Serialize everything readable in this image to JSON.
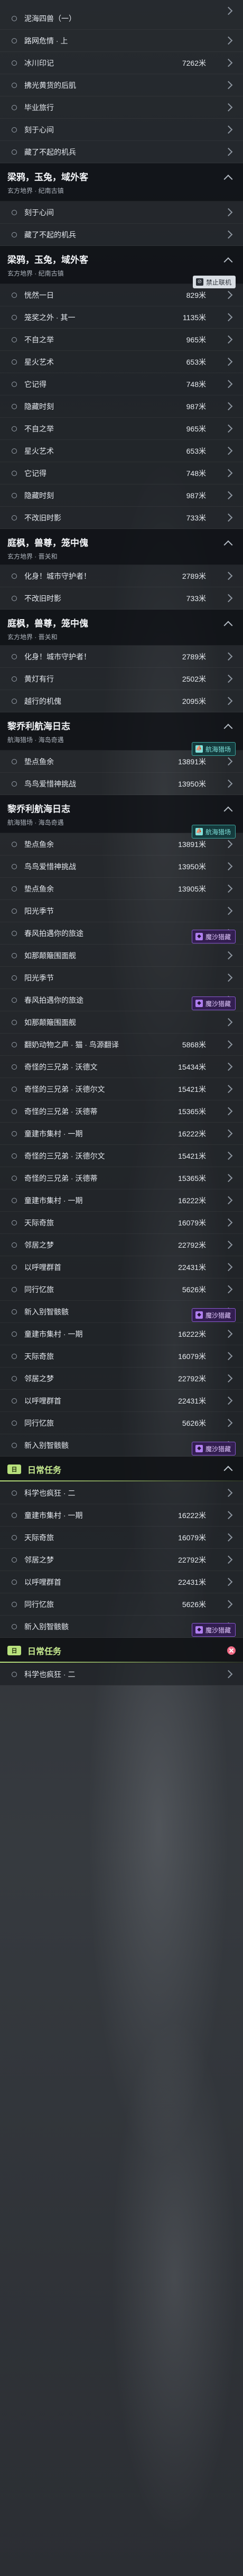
{
  "rows": [
    {
      "kind": "row",
      "name": "泥海四兽（一）",
      "dist": "",
      "lead": true
    },
    {
      "kind": "row",
      "name": "路网危情 · 上",
      "dist": ""
    },
    {
      "kind": "row",
      "name": "冰川印记",
      "dist": "7262米"
    },
    {
      "kind": "row",
      "name": "拂光黄货的后肌",
      "dist": ""
    },
    {
      "kind": "row",
      "name": "毕业旅行",
      "dist": ""
    },
    {
      "kind": "row",
      "name": "刻于心间",
      "dist": ""
    },
    {
      "kind": "row",
      "name": "藏了不起的机兵",
      "dist": ""
    },
    {
      "kind": "header",
      "title": "梁鸦，玉兔，域外客",
      "sub": "玄方地界 · 纪南古镇"
    },
    {
      "kind": "row",
      "name": "刻于心间",
      "dist": ""
    },
    {
      "kind": "row",
      "name": "藏了不起的机兵",
      "dist": ""
    },
    {
      "kind": "header",
      "title": "梁鸦，玉兔，域外客",
      "sub": "玄方地界 · 纪南古镇",
      "badge": {
        "style": "ban",
        "icon": "⊘",
        "text": "禁止联机"
      }
    },
    {
      "kind": "row",
      "name": "恍然一日",
      "dist": "829米"
    },
    {
      "kind": "row",
      "name": "笼奖之外 · 其一",
      "dist": "1135米"
    },
    {
      "kind": "row",
      "name": "不自之举",
      "dist": "965米"
    },
    {
      "kind": "row",
      "name": "星火艺术",
      "dist": "653米"
    },
    {
      "kind": "row",
      "name": "它记得",
      "dist": "748米"
    },
    {
      "kind": "row",
      "name": "隐藏时刻",
      "dist": "987米"
    },
    {
      "kind": "row",
      "name": "不自之举",
      "dist": "965米"
    },
    {
      "kind": "row",
      "name": "星火艺术",
      "dist": "653米"
    },
    {
      "kind": "row",
      "name": "它记得",
      "dist": "748米"
    },
    {
      "kind": "row",
      "name": "隐藏时刻",
      "dist": "987米"
    },
    {
      "kind": "row",
      "name": "不改旧时影",
      "dist": "733米"
    },
    {
      "kind": "header",
      "title": "庭枫，兽尊，笼中傀",
      "sub": "玄方地界 · 晋关和",
      "compact": true
    },
    {
      "kind": "row",
      "name": "化身！城市守护者！",
      "dist": "2789米"
    },
    {
      "kind": "row",
      "name": "不改旧时影",
      "dist": "733米"
    },
    {
      "kind": "header",
      "title": "庭枫，兽尊，笼中傀",
      "sub": "玄方地界 · 晋关和",
      "compact": true
    },
    {
      "kind": "row",
      "name": "化身！城市守护者！",
      "dist": "2789米"
    },
    {
      "kind": "row",
      "name": "黄灯有行",
      "dist": "2502米"
    },
    {
      "kind": "row",
      "name": "越行的机傀",
      "dist": "2095米"
    },
    {
      "kind": "header",
      "title": "黎乔利航海日志",
      "sub": "航海猎场 · 海岛奇遇",
      "badge": {
        "style": "teal",
        "icon": "⛵",
        "text": "航海猎场"
      }
    },
    {
      "kind": "row",
      "name": "垫点鱼余",
      "dist": "13891米"
    },
    {
      "kind": "row",
      "name": "鸟鸟爱惜神挑战",
      "dist": "13950米"
    },
    {
      "kind": "header",
      "title": "黎乔利航海日志",
      "sub": "航海猎场 · 海岛奇遇",
      "badge": {
        "style": "teal",
        "icon": "⛵",
        "text": "航海猎场"
      }
    },
    {
      "kind": "row",
      "name": "垫点鱼余",
      "dist": "13891米"
    },
    {
      "kind": "row",
      "name": "鸟鸟爱惜神挑战",
      "dist": "13950米"
    },
    {
      "kind": "row",
      "name": "垫点鱼余",
      "dist": "13905米"
    },
    {
      "kind": "row",
      "name": "阳光季节",
      "dist": "",
      "badge": {
        "style": "purple",
        "icon": "◆",
        "text": "魔沙猎藏"
      }
    },
    {
      "kind": "row",
      "name": "春风拍遇你的旅途",
      "dist": ""
    },
    {
      "kind": "row",
      "name": "如那颠簸围面舰",
      "dist": ""
    },
    {
      "kind": "row",
      "name": "阳光季节",
      "dist": "",
      "badge": {
        "style": "purple",
        "icon": "◆",
        "text": "魔沙猎藏"
      }
    },
    {
      "kind": "row",
      "name": "春风拍遇你的旅途",
      "dist": ""
    },
    {
      "kind": "row",
      "name": "如那颠簸围面舰",
      "dist": ""
    },
    {
      "kind": "row",
      "name": "翻奶动物之声 · 猫 · 鸟源翻译",
      "dist": "5868米"
    },
    {
      "kind": "row",
      "name": "奇怪的三兄弟 · 沃德文",
      "dist": "15434米"
    },
    {
      "kind": "row",
      "name": "奇怪的三兄弟 · 沃德尔文",
      "dist": "15421米"
    },
    {
      "kind": "row",
      "name": "奇怪的三兄弟 · 沃德蒂",
      "dist": "15365米"
    },
    {
      "kind": "row",
      "name": "童建市集村 · 一期",
      "dist": "16222米"
    },
    {
      "kind": "row",
      "name": "奇怪的三兄弟 · 沃德尔文",
      "dist": "15421米"
    },
    {
      "kind": "row",
      "name": "奇怪的三兄弟 · 沃德蒂",
      "dist": "15365米"
    },
    {
      "kind": "row",
      "name": "童建市集村 · 一期",
      "dist": "16222米"
    },
    {
      "kind": "row",
      "name": "天际奇旅",
      "dist": "16079米"
    },
    {
      "kind": "row",
      "name": "邻居之梦",
      "dist": "22792米"
    },
    {
      "kind": "row",
      "name": "以呼哩群首",
      "dist": "22431米"
    },
    {
      "kind": "row",
      "name": "同行忆旅",
      "dist": "5626米",
      "badge": {
        "style": "purple",
        "icon": "◆",
        "text": "魔沙猎藏"
      }
    },
    {
      "kind": "row",
      "name": "新入别智骸骸",
      "dist": ""
    },
    {
      "kind": "row",
      "name": "童建市集村 · 一期",
      "dist": "16222米"
    },
    {
      "kind": "row",
      "name": "天际奇旅",
      "dist": "16079米"
    },
    {
      "kind": "row",
      "name": "邻居之梦",
      "dist": "22792米"
    },
    {
      "kind": "row",
      "name": "以呼哩群首",
      "dist": "22431米"
    },
    {
      "kind": "row",
      "name": "同行忆旅",
      "dist": "5626米",
      "badge": {
        "style": "purple",
        "icon": "◆",
        "text": "魔沙猎藏"
      }
    },
    {
      "kind": "row",
      "name": "新入别智骸骸",
      "dist": ""
    },
    {
      "kind": "section",
      "tag": "日",
      "title": "日常任务"
    },
    {
      "kind": "row",
      "name": "科学也疯狂 · 二",
      "dist": ""
    },
    {
      "kind": "row",
      "name": "童建市集村 · 一期",
      "dist": "16222米"
    },
    {
      "kind": "row",
      "name": "天际奇旅",
      "dist": "16079米"
    },
    {
      "kind": "row",
      "name": "邻居之梦",
      "dist": "22792米"
    },
    {
      "kind": "row",
      "name": "以呼哩群首",
      "dist": "22431米"
    },
    {
      "kind": "row",
      "name": "同行忆旅",
      "dist": "5626米",
      "badge": {
        "style": "purple",
        "icon": "◆",
        "text": "魔沙猎藏"
      }
    },
    {
      "kind": "row",
      "name": "新入别智骸骸",
      "dist": ""
    },
    {
      "kind": "section",
      "tag": "日",
      "title": "日常任务",
      "close": true
    },
    {
      "kind": "row",
      "name": "科学也疯狂 · 二",
      "dist": ""
    }
  ]
}
